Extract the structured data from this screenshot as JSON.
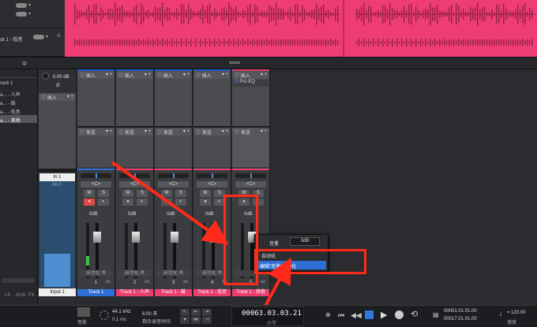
{
  "arrange": {
    "tracks": [
      {
        "label": "",
        "color": "#ee3d74"
      },
      {
        "label": "ck 1 - 低音",
        "color": "#ee3d74"
      }
    ],
    "ruler_label": "中"
  },
  "left_panel": {
    "db": "0.00 dB",
    "phase": "Ø",
    "items": [
      "rack 1",
      "a... - 人声",
      "a... - 鼓",
      "a... - 低音",
      "a... - 其他"
    ],
    "footer": [
      "I:3",
      "AUX",
      "FX"
    ]
  },
  "input_channel": {
    "name": "In 1",
    "value": "-36.0",
    "label": "Input 1"
  },
  "slots": {
    "insert": "插入",
    "send": "发送",
    "pro_eq": "Pro EQ"
  },
  "channels": [
    {
      "num": "1",
      "name": "Track 1",
      "pan": "<C>",
      "vol": "0dB",
      "auto": "自动化:关",
      "color": "#2f6ed8"
    },
    {
      "num": "2",
      "name": "Track 1 - 人声",
      "pan": "<C>",
      "vol": "0dB",
      "auto": "自动化:关",
      "color": "#e8406e"
    },
    {
      "num": "3",
      "name": "Track 1 - 鼓",
      "pan": "<C>",
      "vol": "0dB",
      "auto": "自动化:关",
      "color": "#e8406e"
    },
    {
      "num": "4",
      "name": "Track 1 - 低音",
      "pan": "<C>",
      "vol": "0dB",
      "auto": "自动化:关",
      "color": "#e8406e"
    },
    {
      "num": "5",
      "name": "Track 1 - 其他",
      "pan": "<C>",
      "vol": "0dB",
      "auto": "",
      "color": "#e8406e"
    }
  ],
  "buttons": {
    "m": "M",
    "s": "S"
  },
  "popup": {
    "vol_label": "音量",
    "vol_value": "0dB",
    "auto_label": "自动化",
    "edit_item": "编辑\"音量\"自动化"
  },
  "transport": {
    "perf": "性能",
    "sample_rate": "44.1 kHz",
    "latency": "0.1 ms",
    "time": "6:00 天",
    "time_label": "剩余录音时间",
    "position": "00063.03.03.21",
    "pos_unit": "小节",
    "loop_start": "00001.01.01.00",
    "loop_end": "00017.01.01.00",
    "tempo": "120.00",
    "tempo_label": "速度"
  }
}
